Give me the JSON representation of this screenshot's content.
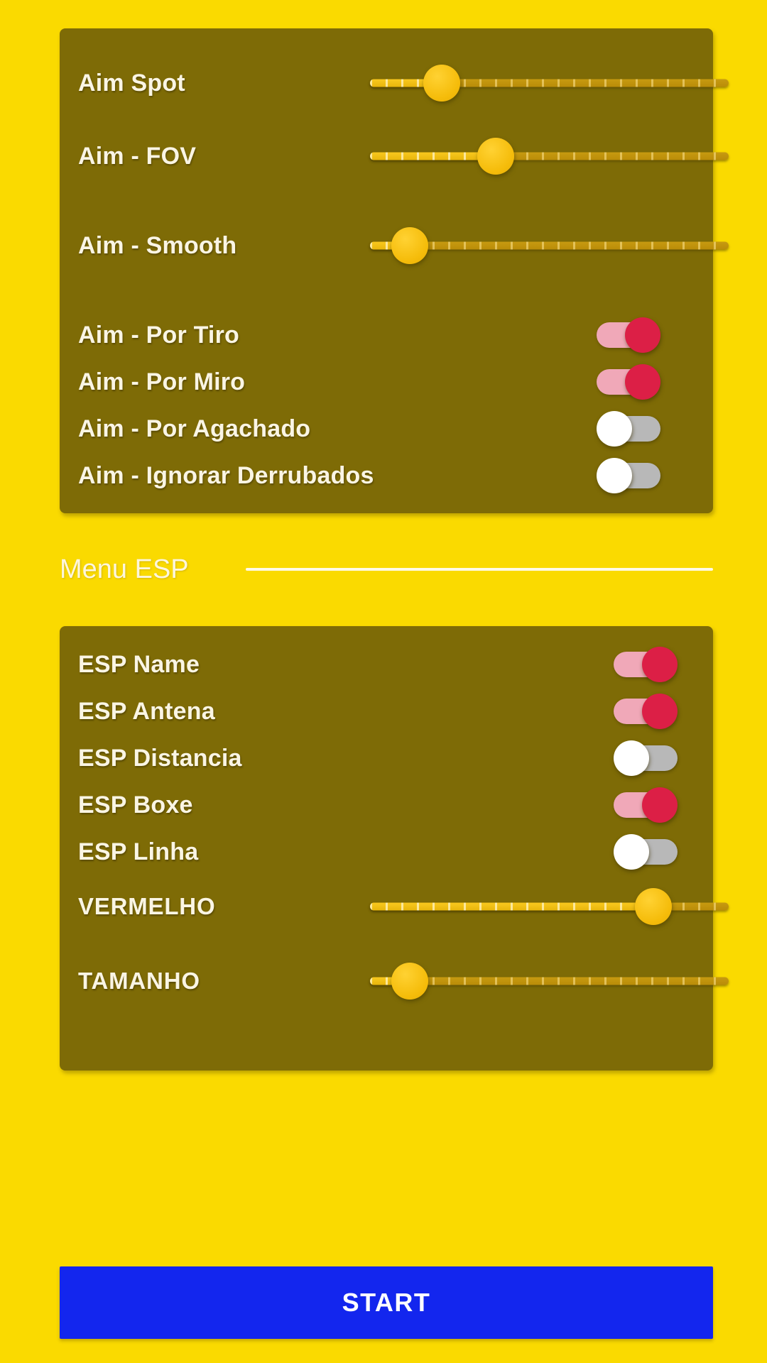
{
  "theme": {
    "background": "#FADA00",
    "card_background": "#7E6B06",
    "label_color": "#FAF5E4",
    "toggle_on_track": "#F0A8B8",
    "toggle_on_thumb": "#DC1F46",
    "toggle_off_track": "#B8B8B8",
    "toggle_off_thumb": "#FFFFFF",
    "slider_accent": "#F5BC0A",
    "slider_track": "#C79A10",
    "start_button_color": "#1326EE"
  },
  "aim_card": {
    "sliders": [
      {
        "label": "Aim Spot",
        "value": 20,
        "min": 0,
        "max": 100
      },
      {
        "label": "Aim - FOV",
        "value": 35,
        "min": 0,
        "max": 100
      },
      {
        "label": "Aim - Smooth",
        "value": 11,
        "min": 0,
        "max": 100
      }
    ],
    "toggles": [
      {
        "label": "Aim - Por Tiro",
        "state": "on"
      },
      {
        "label": "Aim - Por Miro",
        "state": "on"
      },
      {
        "label": "Aim - Por Agachado",
        "state": "off"
      },
      {
        "label": "Aim - Ignorar Derrubados",
        "state": "off"
      }
    ]
  },
  "section_esp": {
    "title": "Menu ESP"
  },
  "esp_card": {
    "toggles": [
      {
        "label": "ESP Name",
        "state": "on"
      },
      {
        "label": "ESP Antena",
        "state": "on"
      },
      {
        "label": "ESP Distancia",
        "state": "off"
      },
      {
        "label": "ESP Boxe",
        "state": "on"
      },
      {
        "label": "ESP Linha",
        "state": "off"
      }
    ],
    "sliders": [
      {
        "label": "VERMELHO",
        "value": 79,
        "min": 0,
        "max": 100
      },
      {
        "label": "TAMANHO",
        "value": 11,
        "min": 0,
        "max": 100
      }
    ]
  },
  "footer": {
    "start_label": "START"
  }
}
